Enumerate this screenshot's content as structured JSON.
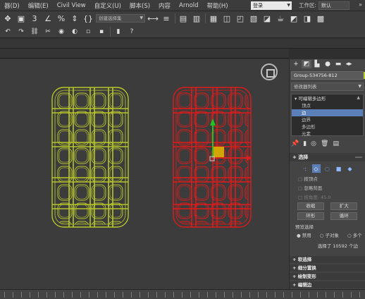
{
  "menu": {
    "items": [
      "器(D)",
      "编辑(E)",
      "Civil View",
      "自定义(U)",
      "脚本(S)",
      "内容",
      "Arnold",
      "帮助(H)"
    ],
    "search_value": "登录",
    "workspace_label": "工作区:",
    "workspace_value": "默认"
  },
  "toolbar": {
    "selection_set_placeholder": "创建选择集"
  },
  "panel": {
    "object_name": "Group-534756-812",
    "object_color": "#b5cc2c",
    "modifier_list": "修改器列表",
    "stack": {
      "root": "可编辑多边形",
      "children": [
        "顶点",
        "边",
        "边界",
        "多边形",
        "元素"
      ],
      "selected_index": 1
    },
    "selection": {
      "title": "选择",
      "by_vertex": "按顶点",
      "ignore_backfacing": "忽略背面",
      "by_angle": "按角度: 45.0",
      "shrink": "收缩",
      "grow": "扩大",
      "ring": "环形",
      "loop": "循环",
      "preview_label": "预览选择",
      "preview_options": [
        "禁用",
        "子对象",
        "多个"
      ],
      "selected_text": "选择了 10592 个边"
    },
    "collapsed_rollouts": [
      "软选择",
      "细分置换",
      "绘制变形",
      "编辑边"
    ]
  },
  "colors": {
    "viewport_bg": "#3c3c3c",
    "mesh_unselected": "#b8c62a",
    "mesh_selected": "#e01a1a",
    "gizmo_x": "#d42020",
    "gizmo_y": "#22c422",
    "gizmo_plane": "#e0b000"
  }
}
